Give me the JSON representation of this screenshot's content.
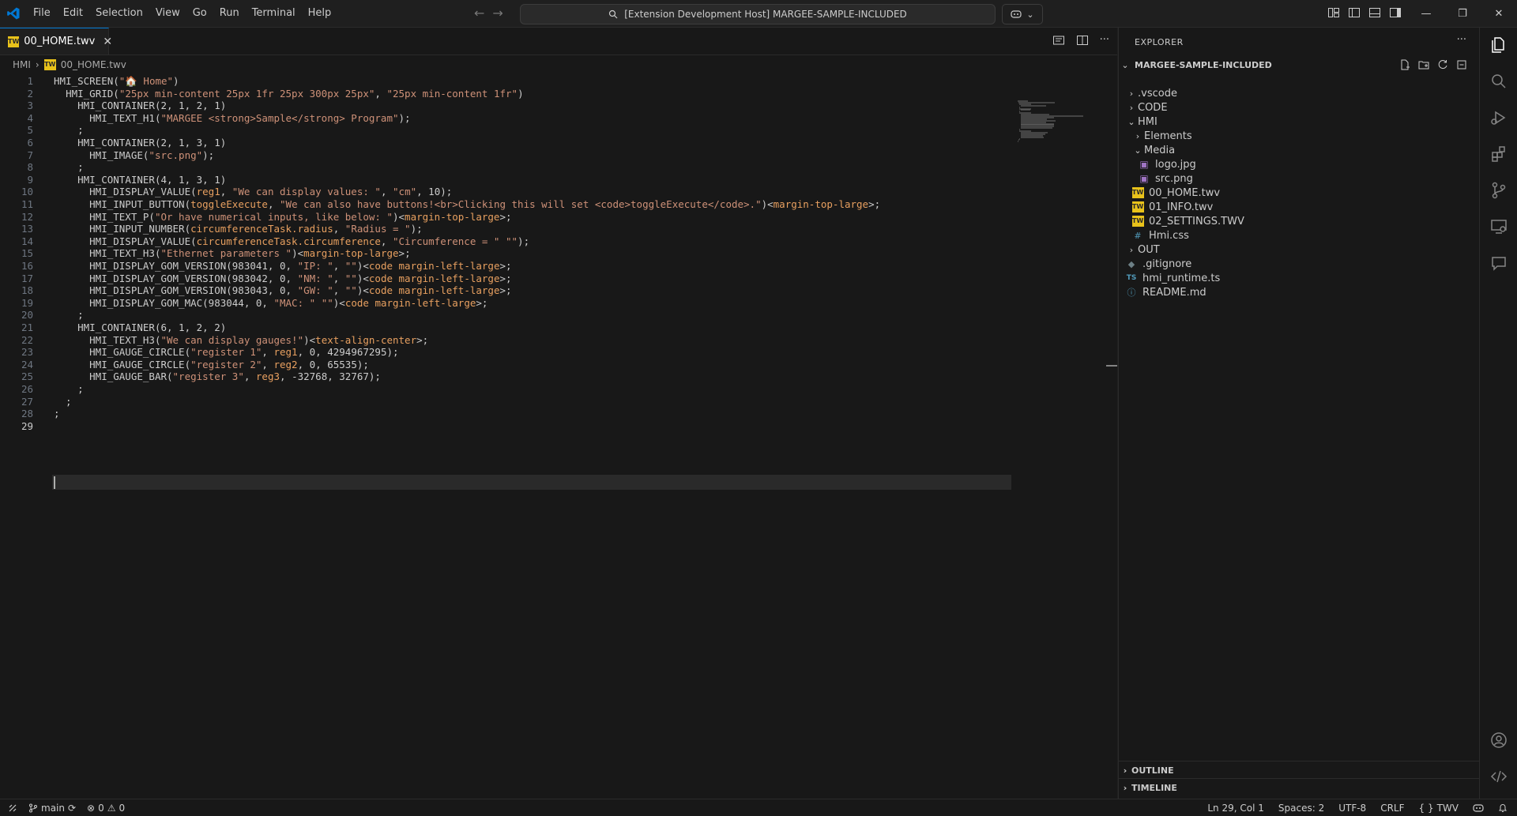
{
  "menu": [
    "File",
    "Edit",
    "Selection",
    "View",
    "Go",
    "Run",
    "Terminal",
    "Help"
  ],
  "command_center": "[Extension Development Host] MARGEE-SAMPLE-INCLUDED",
  "tab": {
    "label": "00_HOME.twv",
    "icon": "TW"
  },
  "breadcrumb": {
    "folder": "HMI",
    "file": "00_HOME.twv"
  },
  "code_lines": [
    {
      "num": "1",
      "text": "HMI_SCREEN(\"🏠 Home\")"
    },
    {
      "num": "2",
      "text": "  HMI_GRID(\"25px min-content 25px 1fr 25px 300px 25px\", \"25px min-content 1fr\")"
    },
    {
      "num": "3",
      "text": "    HMI_CONTAINER(2, 1, 2, 1)"
    },
    {
      "num": "4",
      "text": "      HMI_TEXT_H1(\"MARGEE <strong>Sample</strong> Program\");"
    },
    {
      "num": "5",
      "text": "    ;"
    },
    {
      "num": "6",
      "text": "    HMI_CONTAINER(2, 1, 3, 1)"
    },
    {
      "num": "7",
      "text": "      HMI_IMAGE(\"src.png\");"
    },
    {
      "num": "8",
      "text": "    ;"
    },
    {
      "num": "9",
      "text": "    HMI_CONTAINER(4, 1, 3, 1)"
    },
    {
      "num": "10",
      "text": "      HMI_DISPLAY_VALUE(reg1, \"We can display values: \", \"cm\", 10);"
    },
    {
      "num": "11",
      "text": "      HMI_INPUT_BUTTON(toggleExecute, \"We can also have buttons!<br>Clicking this will set <code>toggleExecute</code>.\")<margin-top-large>;"
    },
    {
      "num": "12",
      "text": "      HMI_TEXT_P(\"Or have numerical inputs, like below: \")<margin-top-large>;"
    },
    {
      "num": "13",
      "text": "      HMI_INPUT_NUMBER(circumferenceTask.radius, \"Radius = \");"
    },
    {
      "num": "14",
      "text": "      HMI_DISPLAY_VALUE(circumferenceTask.circumference, \"Circumference = \" \"\");"
    },
    {
      "num": "15",
      "text": "      HMI_TEXT_H3(\"Ethernet parameters \")<margin-top-large>;"
    },
    {
      "num": "16",
      "text": "      HMI_DISPLAY_GOM_VERSION(983041, 0, \"IP: \", \"\")<code margin-left-large>;"
    },
    {
      "num": "17",
      "text": "      HMI_DISPLAY_GOM_VERSION(983042, 0, \"NM: \", \"\")<code margin-left-large>;"
    },
    {
      "num": "18",
      "text": "      HMI_DISPLAY_GOM_VERSION(983043, 0, \"GW: \", \"\")<code margin-left-large>;"
    },
    {
      "num": "19",
      "text": "      HMI_DISPLAY_GOM_MAC(983044, 0, \"MAC: \" \"\")<code margin-left-large>;"
    },
    {
      "num": "20",
      "text": "    ;"
    },
    {
      "num": "21",
      "text": "    HMI_CONTAINER(6, 1, 2, 2)"
    },
    {
      "num": "22",
      "text": "      HMI_TEXT_H3(\"We can display gauges!\")<text-align-center>;"
    },
    {
      "num": "23",
      "text": "      HMI_GAUGE_CIRCLE(\"register 1\", reg1, 0, 4294967295);"
    },
    {
      "num": "24",
      "text": "      HMI_GAUGE_CIRCLE(\"register 2\", reg2, 0, 65535);"
    },
    {
      "num": "25",
      "text": "      HMI_GAUGE_BAR(\"register 3\", reg3, -32768, 32767);"
    },
    {
      "num": "26",
      "text": "    ;"
    },
    {
      "num": "27",
      "text": "  ;"
    },
    {
      "num": "28",
      "text": ";"
    },
    {
      "num": "29",
      "text": ""
    }
  ],
  "explorer": {
    "title": "EXPLORER",
    "root": "MARGEE-SAMPLE-INCLUDED",
    "items": [
      {
        "label": ".vscode",
        "depth": 0,
        "kind": "folder",
        "open": false
      },
      {
        "label": "CODE",
        "depth": 0,
        "kind": "folder",
        "open": false
      },
      {
        "label": "HMI",
        "depth": 0,
        "kind": "folder",
        "open": true
      },
      {
        "label": "Elements",
        "depth": 1,
        "kind": "folder",
        "open": false
      },
      {
        "label": "Media",
        "depth": 1,
        "kind": "folder",
        "open": true
      },
      {
        "label": "logo.jpg",
        "depth": 2,
        "kind": "image"
      },
      {
        "label": "src.png",
        "depth": 2,
        "kind": "image"
      },
      {
        "label": "00_HOME.twv",
        "depth": 1,
        "kind": "twv"
      },
      {
        "label": "01_INFO.twv",
        "depth": 1,
        "kind": "twv"
      },
      {
        "label": "02_SETTINGS.TWV",
        "depth": 1,
        "kind": "twv"
      },
      {
        "label": "Hmi.css",
        "depth": 1,
        "kind": "css"
      },
      {
        "label": "OUT",
        "depth": 0,
        "kind": "folder",
        "open": false
      },
      {
        "label": ".gitignore",
        "depth": 0,
        "kind": "gitignore"
      },
      {
        "label": "hmi_runtime.ts",
        "depth": 0,
        "kind": "ts"
      },
      {
        "label": "README.md",
        "depth": 0,
        "kind": "info"
      }
    ]
  },
  "panels": {
    "outline": "OUTLINE",
    "timeline": "TIMELINE"
  },
  "status": {
    "branch": "main",
    "errors": "0",
    "warnings": "0",
    "position": "Ln 29, Col 1",
    "spaces": "Spaces: 2",
    "encoding": "UTF-8",
    "eol": "CRLF",
    "language": "TWV",
    "language_braces": "{ }"
  },
  "colors": {
    "string": "#ce9178",
    "identifier": "#e8a060",
    "function": "#dcdcaa",
    "text": "#cccccc",
    "accent": "#0078d4",
    "twv_icon": "#e8c21a"
  }
}
